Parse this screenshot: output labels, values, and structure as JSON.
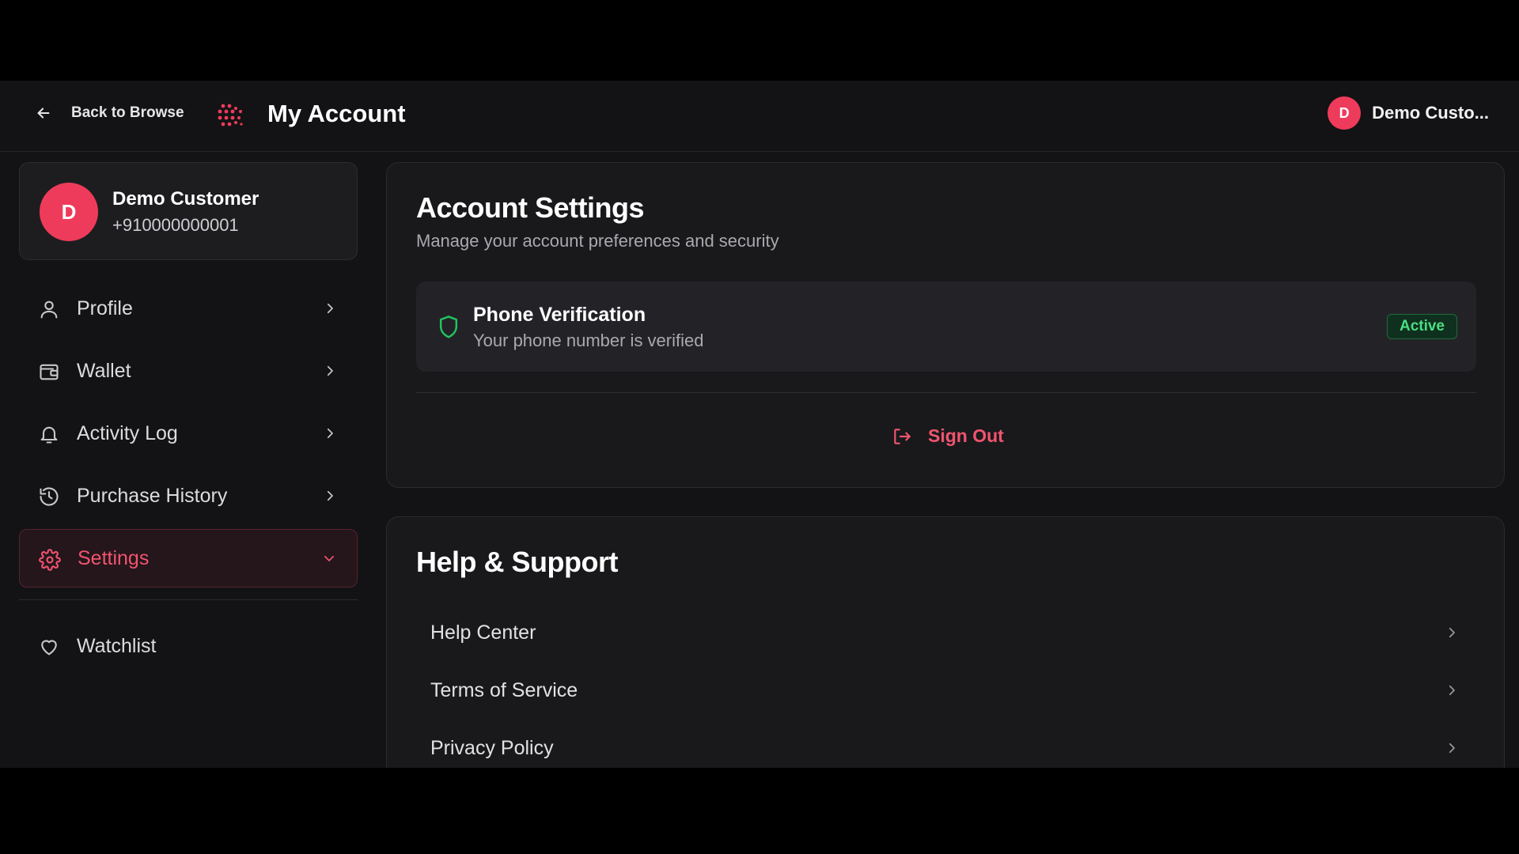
{
  "header": {
    "back_label": "Back to Browse",
    "title": "My Account",
    "user_initial": "D",
    "user_name": "Demo Custo..."
  },
  "profile": {
    "initial": "D",
    "name": "Demo Customer",
    "phone": "+910000000001"
  },
  "sidebar": {
    "items": [
      {
        "label": "Profile",
        "icon": "user-icon"
      },
      {
        "label": "Wallet",
        "icon": "wallet-icon"
      },
      {
        "label": "Activity Log",
        "icon": "bell-icon"
      },
      {
        "label": "Purchase History",
        "icon": "history-icon"
      },
      {
        "label": "Settings",
        "icon": "gear-icon",
        "active": true
      },
      {
        "label": "Watchlist",
        "icon": "heart-icon"
      }
    ]
  },
  "account_settings": {
    "title": "Account Settings",
    "subtitle": "Manage your account preferences and security",
    "phone_verification": {
      "title": "Phone Verification",
      "subtitle": "Your phone number is verified",
      "status": "Active"
    },
    "sign_out_label": "Sign Out"
  },
  "help_support": {
    "title": "Help & Support",
    "items": [
      "Help Center",
      "Terms of Service",
      "Privacy Policy"
    ]
  },
  "colors": {
    "accent": "#ef3b5b",
    "accent_text": "#f2546f",
    "success": "#4ade80",
    "background": "#131315",
    "panel": "#19191c"
  }
}
